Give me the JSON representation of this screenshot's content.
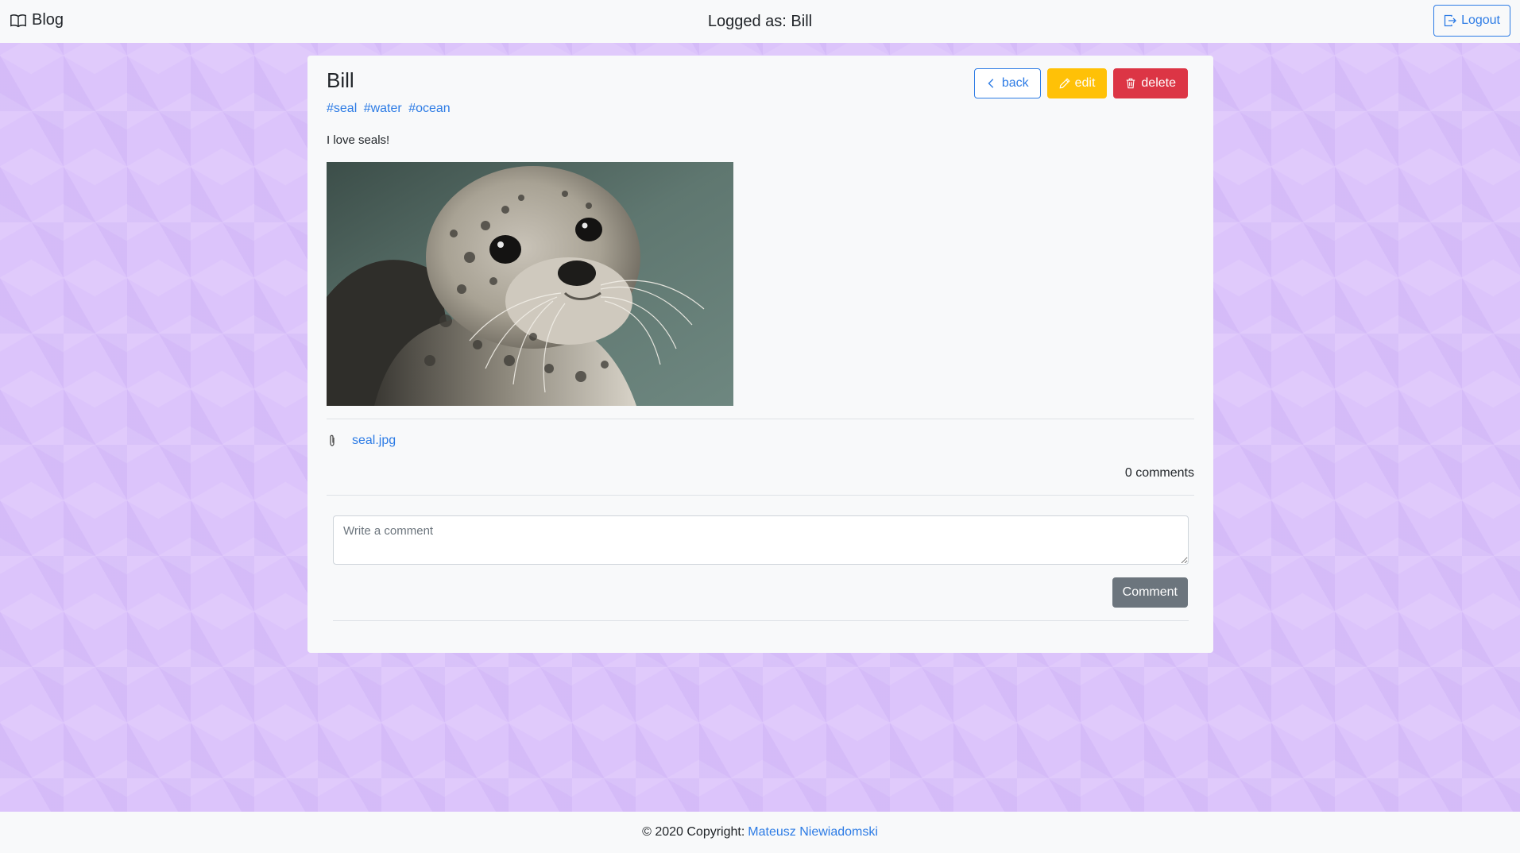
{
  "header": {
    "brand_label": "Blog",
    "logged_as": "Logged as: Bill",
    "logout_label": "Logout"
  },
  "post": {
    "author": "Bill",
    "tags": [
      "#seal",
      "#water",
      "#ocean"
    ],
    "text": "I love seals!",
    "image_alt": "seal photo",
    "attachment_name": "seal.jpg",
    "comments_count_text": "0 comments"
  },
  "actions": {
    "back_label": "back",
    "edit_label": "edit",
    "delete_label": "delete"
  },
  "comment_form": {
    "placeholder": "Write a comment",
    "value": "",
    "submit_label": "Comment"
  },
  "footer": {
    "copyright_text": "© 2020 Copyright:",
    "author_link": "Mateusz Niewiadomski"
  },
  "colors": {
    "page_background": "#dcc4fb",
    "primary": "#2c7be5",
    "warning": "#ffc107",
    "danger": "#dc3545",
    "secondary": "#6c757d",
    "light": "#f8f9fa"
  },
  "icons": {
    "brand": "book-icon",
    "logout": "logout-icon",
    "back": "chevron-left-icon",
    "edit": "pencil-icon",
    "delete": "trash-icon",
    "attachment": "paperclip-icon"
  }
}
